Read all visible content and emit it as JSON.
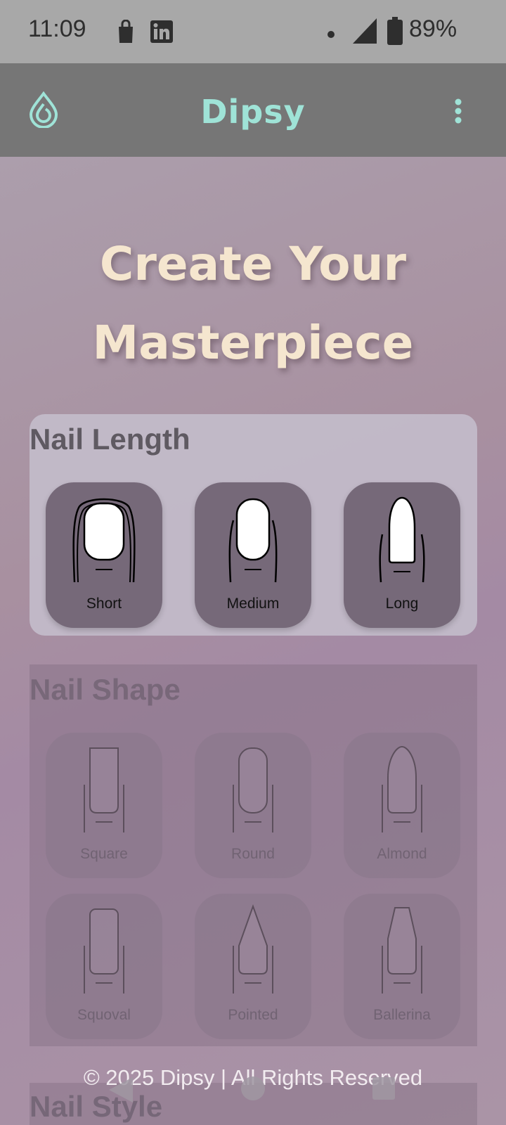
{
  "status_bar": {
    "time": "11:09",
    "battery": "89%",
    "icons": [
      "shopping-bag-icon",
      "linkedin-icon",
      "dot-icon",
      "signal-icon",
      "battery-icon"
    ]
  },
  "app_bar": {
    "title": "Dipsy",
    "logo_icon": "water-drop-icon",
    "menu_icon": "more-vert-icon",
    "accent_color": "#9fe3d7"
  },
  "hero": {
    "line1": "Create Your",
    "line2": "Masterpiece"
  },
  "nail_length": {
    "title": "Nail Length",
    "options": [
      {
        "label": "Short"
      },
      {
        "label": "Medium"
      },
      {
        "label": "Long"
      }
    ]
  },
  "nail_shape": {
    "title": "Nail Shape",
    "options": [
      {
        "label": "Square"
      },
      {
        "label": "Round"
      },
      {
        "label": "Almond"
      },
      {
        "label": "Squoval"
      },
      {
        "label": "Pointed"
      },
      {
        "label": "Ballerina"
      }
    ]
  },
  "nail_style": {
    "title": "Nail Style"
  },
  "footer": {
    "text": "© 2025 Dipsy | All Rights Reserved"
  },
  "nav_bar": {
    "icons": [
      "back-icon",
      "home-icon",
      "recents-icon"
    ]
  }
}
